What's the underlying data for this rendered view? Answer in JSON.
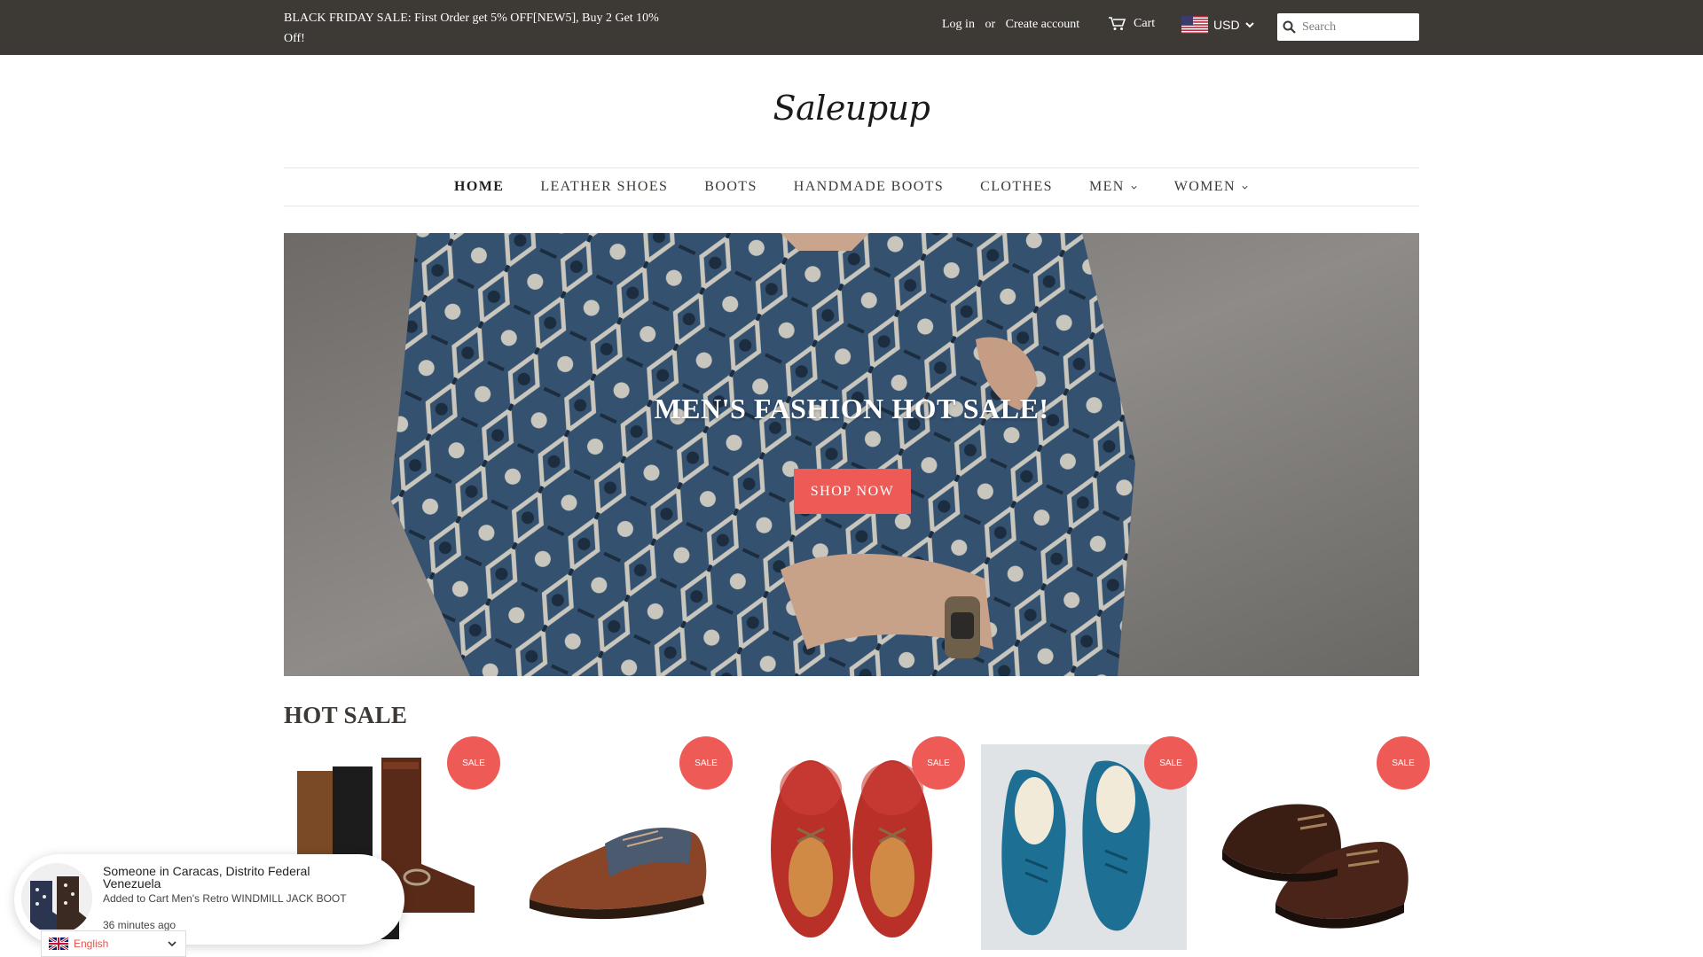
{
  "topbar": {
    "promo": "BLACK FRIDAY SALE: First Order get 5% OFF[NEW5], Buy 2 Get 10% Off!",
    "login": "Log in",
    "or": "or",
    "create_account": "Create account",
    "cart": "Cart",
    "currency": "USD",
    "search_placeholder": "Search"
  },
  "logo": "Saleupup",
  "nav": {
    "items": [
      {
        "label": "HOME",
        "active": true
      },
      {
        "label": "LEATHER SHOES"
      },
      {
        "label": "BOOTS"
      },
      {
        "label": "HANDMADE BOOTS"
      },
      {
        "label": "CLOTHES"
      },
      {
        "label": "MEN",
        "dropdown": true
      },
      {
        "label": "WOMEN",
        "dropdown": true
      }
    ]
  },
  "hero": {
    "title": "MEN'S FASHION HOT SALE!",
    "button": "SHOP NOW"
  },
  "hot_sale": {
    "title": "HOT SALE",
    "products": [
      {
        "image": "brown and black engineer boots",
        "badge": "SALE"
      },
      {
        "image": "brown and navy brogue shoe",
        "badge": "SALE"
      },
      {
        "image": "red leather derby shoes",
        "badge": "SALE"
      },
      {
        "image": "blue leather shoes",
        "badge": "SALE"
      },
      {
        "image": "dark brown leather derby shoes",
        "badge": "SALE"
      }
    ]
  },
  "notification": {
    "line1": "Someone in Caracas, Distrito Federal Venezuela",
    "line2": "Added to Cart Men's Retro WINDMILL JACK BOOT",
    "line3": "36 minutes ago"
  },
  "language": {
    "selected": "English"
  },
  "colors": {
    "topbar_bg": "#3d3935",
    "accent": "#ee5b57"
  }
}
